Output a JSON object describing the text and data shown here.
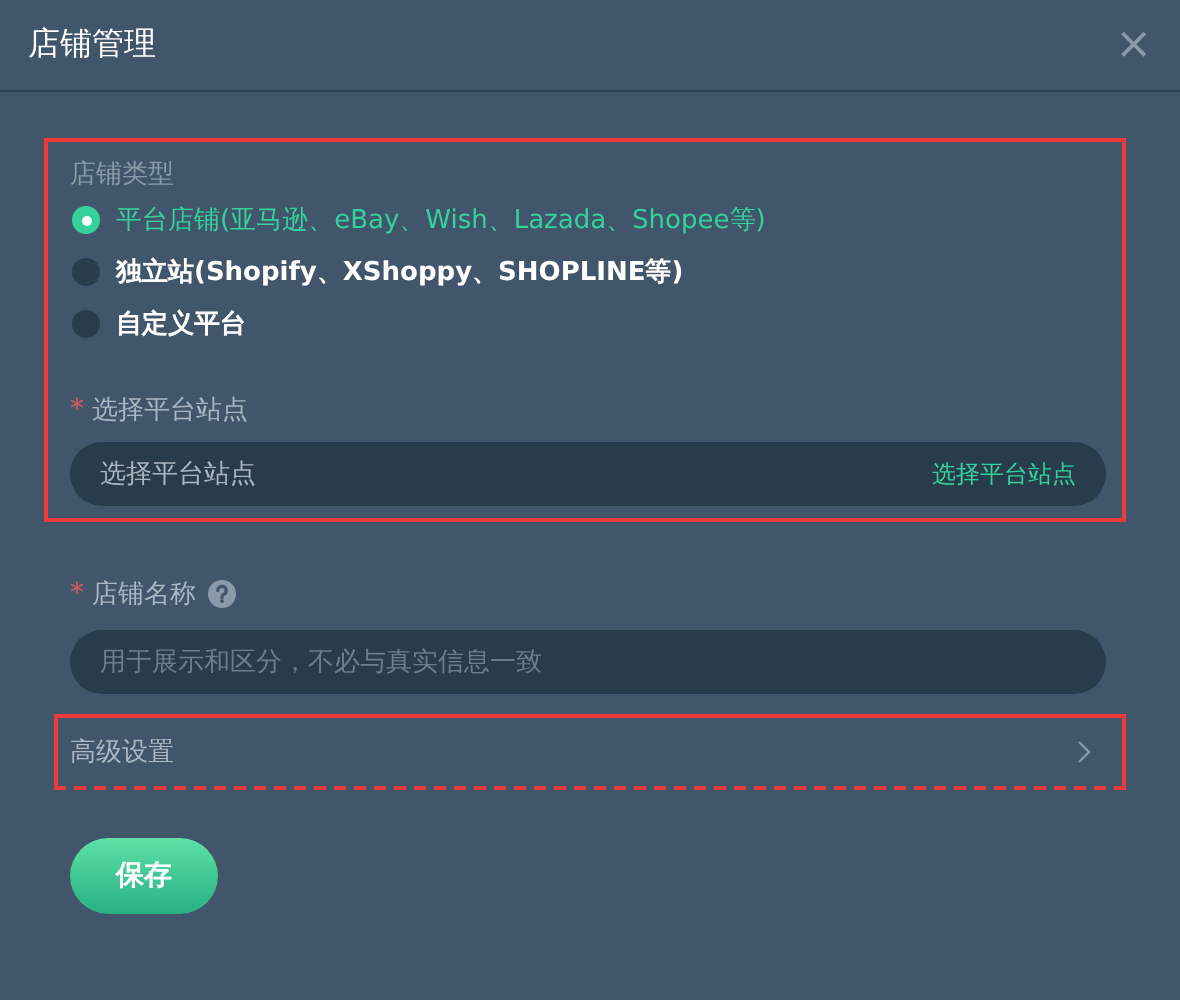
{
  "dialog": {
    "title": "店铺管理",
    "close": "×"
  },
  "store_type": {
    "highlighted": true,
    "label": "店铺类型",
    "options": [
      {
        "label": "平台店铺(亚马逊、eBay、Wish、Lazada、Shopee等)",
        "selected": true
      },
      {
        "label": "独立站(Shopify、XShoppy、SHOPLINE等)",
        "selected": false
      },
      {
        "label": "自定义平台",
        "selected": false
      }
    ],
    "site": {
      "required_mark": "*",
      "label": "选择平台站点",
      "placeholder": "选择平台站点",
      "action": "选择平台站点"
    }
  },
  "store_name": {
    "required_mark": "*",
    "label": "店铺名称",
    "placeholder": "用于展示和区分，不必与真实信息一致"
  },
  "advanced": {
    "highlighted": true,
    "label": "高级设置",
    "expanded": false
  },
  "save_button": "保存"
}
